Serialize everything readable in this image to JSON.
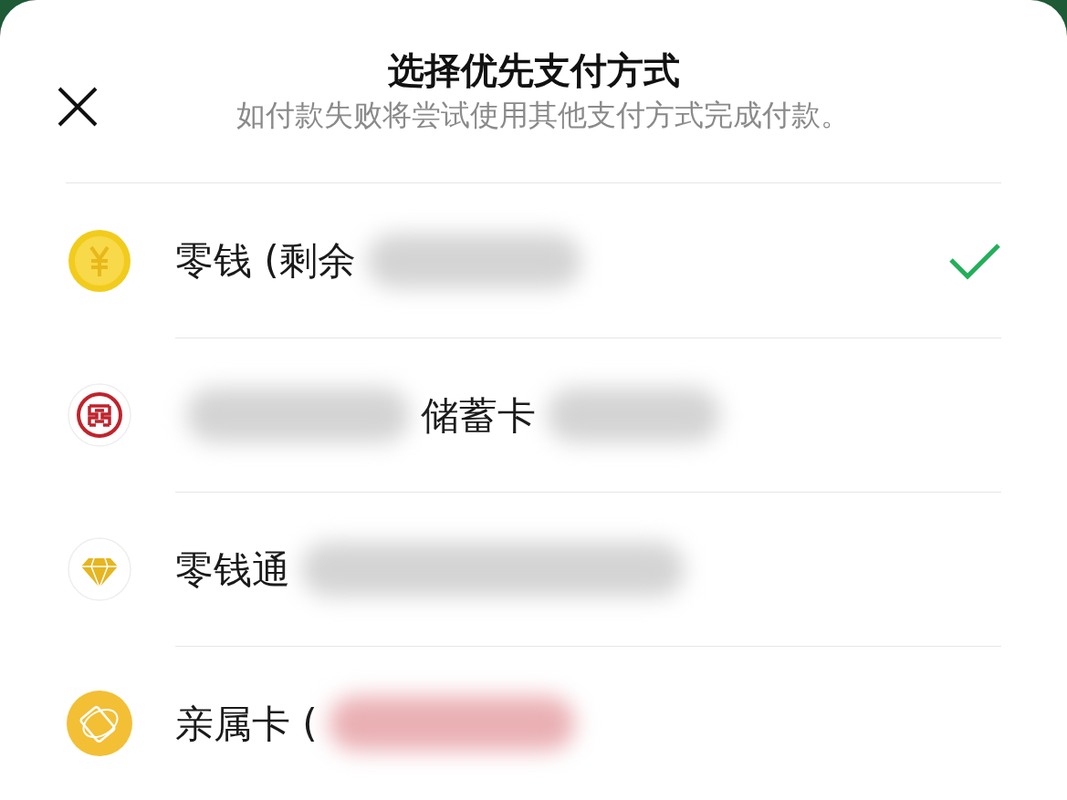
{
  "sheet": {
    "title": "选择优先支付方式",
    "subtitle": "如付款失败将尝试使用其他支付方式完成付款。"
  },
  "methods": [
    {
      "kind": "coin",
      "selected": true,
      "segments": [
        {
          "kind": "text",
          "text": "零钱 (剩余"
        },
        {
          "kind": "redacted",
          "color": "#d4d4d4"
        }
      ]
    },
    {
      "kind": "bank",
      "selected": false,
      "segments": [
        {
          "kind": "redacted",
          "color": "#d4d4d4"
        },
        {
          "kind": "text",
          "text": "储蓄卡"
        },
        {
          "kind": "redacted",
          "color": "#d4d4d4"
        }
      ]
    },
    {
      "kind": "diamond",
      "selected": false,
      "segments": [
        {
          "kind": "text",
          "text": "零钱通"
        },
        {
          "kind": "redacted",
          "color": "#d4d4d4"
        }
      ]
    },
    {
      "kind": "family",
      "selected": false,
      "segments": [
        {
          "kind": "text",
          "text": "亲属卡 ("
        },
        {
          "kind": "redacted",
          "color": "#eab0b4"
        }
      ]
    }
  ]
}
